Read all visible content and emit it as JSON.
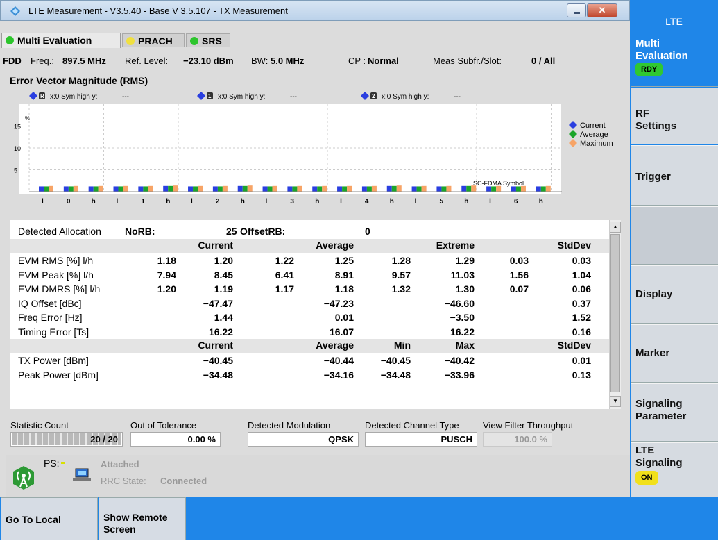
{
  "window": {
    "title": "LTE Measurement  - V3.5.40 - Base V 3.5.107 - TX Measurement"
  },
  "tabs": [
    {
      "label": "Multi Evaluation",
      "color": "#2cc52c"
    },
    {
      "label": "PRACH",
      "color": "#f0e040"
    },
    {
      "label": "SRS",
      "color": "#2cc52c"
    }
  ],
  "info": {
    "duplex": "FDD",
    "freq_label": "Freq.:",
    "freq_value": "897.5 MHz",
    "ref_label": "Ref. Level:",
    "ref_value": "−23.10 dBm",
    "bw_label": "BW:",
    "bw_value": "5.0 MHz",
    "cp_label": "CP :",
    "cp_value": "Normal",
    "meas_label": "Meas Subfr./Slot:",
    "meas_value": "0  / All"
  },
  "evm_title": "Error Vector Magnitude (RMS)",
  "markers": [
    {
      "num": "R",
      "text": "x:0 Sym high y:",
      "val": "---"
    },
    {
      "num": "1",
      "text": "x:0 Sym high y:",
      "val": "---"
    },
    {
      "num": "2",
      "text": "x:0 Sym high y:",
      "val": "---"
    }
  ],
  "chart_data": {
    "type": "bar",
    "ylabel": "%",
    "xlabel": "SC-FDMA Symbol",
    "ylim": [
      0,
      20
    ],
    "yticks": [
      "15",
      "10",
      "5"
    ],
    "categories": [
      "l",
      "0",
      "h",
      "l",
      "1",
      "h",
      "l",
      "2",
      "h",
      "l",
      "3",
      "h",
      "l",
      "4",
      "h",
      "l",
      "5",
      "h",
      "l",
      "6",
      "h"
    ],
    "series": [
      {
        "name": "Current",
        "color": "#2a3fe0",
        "values": [
          1.2,
          1.2,
          1.2,
          1.2,
          1.2,
          1.3,
          1.2,
          1.2,
          1.3,
          1.2,
          1.2,
          1.2,
          1.2,
          1.2,
          1.3,
          1.2,
          1.2,
          1.3,
          1.2,
          1.2,
          1.2
        ]
      },
      {
        "name": "Average",
        "color": "#1ba52a",
        "values": [
          1.2,
          1.2,
          1.2,
          1.2,
          1.2,
          1.3,
          1.2,
          1.2,
          1.3,
          1.2,
          1.2,
          1.2,
          1.2,
          1.2,
          1.3,
          1.2,
          1.2,
          1.3,
          1.2,
          1.2,
          1.2
        ]
      },
      {
        "name": "Maximum",
        "color": "#f7a466",
        "values": [
          1.3,
          1.3,
          1.3,
          1.3,
          1.3,
          1.4,
          1.3,
          1.3,
          1.4,
          1.3,
          1.3,
          1.3,
          1.3,
          1.3,
          1.4,
          1.3,
          1.3,
          1.4,
          1.3,
          1.3,
          1.3
        ]
      }
    ],
    "legend": "right"
  },
  "allocation": {
    "label": "Detected Allocation",
    "norb_label": "NoRB:",
    "norb_value": "25",
    "offset_label": "OffsetRB:",
    "offset_value": "0"
  },
  "headers1": [
    "Current",
    "Average",
    "Extreme",
    "StdDev"
  ],
  "rows1": [
    {
      "label": "EVM RMS [%] l/h",
      "values": [
        "1.18",
        "1.20",
        "1.22",
        "1.25",
        "1.28",
        "1.29",
        "0.03",
        "0.03"
      ]
    },
    {
      "label": "EVM Peak [%] l/h",
      "values": [
        "7.94",
        "8.45",
        "6.41",
        "8.91",
        "9.57",
        "11.03",
        "1.56",
        "1.04"
      ]
    },
    {
      "label": "EVM DMRS [%] l/h",
      "values": [
        "1.20",
        "1.19",
        "1.17",
        "1.18",
        "1.32",
        "1.30",
        "0.07",
        "0.06"
      ]
    },
    {
      "label": "IQ Offset [dBc]",
      "values": [
        "",
        "−47.47",
        "",
        "−47.23",
        "",
        "−46.60",
        "",
        "0.37"
      ]
    },
    {
      "label": "Freq Error [Hz]",
      "values": [
        "",
        "1.44",
        "",
        "0.01",
        "",
        "−3.50",
        "",
        "1.52"
      ]
    },
    {
      "label": "Timing Error [Ts]",
      "values": [
        "",
        "16.22",
        "",
        "16.07",
        "",
        "16.22",
        "",
        "0.16"
      ]
    }
  ],
  "headers2": [
    "Current",
    "Average",
    "Min",
    "Max",
    "StdDev"
  ],
  "rows2": [
    {
      "label": "TX Power [dBm]",
      "values": [
        "−40.45",
        "−40.44",
        "−40.45",
        "−40.42",
        "0.01"
      ]
    },
    {
      "label": "Peak Power [dBm]",
      "values": [
        "−34.48",
        "−34.16",
        "−34.48",
        "−33.96",
        "0.13"
      ]
    }
  ],
  "bottom": {
    "stat_label": "Statistic Count",
    "stat_value": "20 / 20",
    "stat_fraction": 1.0,
    "tol_label": "Out of Tolerance",
    "tol_value": "0.00  %",
    "mod_label": "Detected Modulation",
    "mod_value": "QPSK",
    "chan_label": "Detected Channel Type",
    "chan_value": "PUSCH",
    "vft_label": "View Filter Throughput",
    "vft_value": "100.0  %"
  },
  "status": {
    "ps_label": "PS:",
    "attached": "Attached",
    "rrc_label": "RRC State:",
    "rrc_value": "Connected"
  },
  "bottom_buttons": [
    {
      "label": "Go To Local"
    },
    {
      "label": "Show Remote Screen"
    }
  ],
  "right": {
    "header": "LTE",
    "buttons": [
      {
        "label": "Multi Evaluation",
        "badge": "RDY"
      },
      {
        "label": "RF Settings"
      },
      {
        "label": "Trigger"
      },
      {
        "label": ""
      },
      {
        "label": "Display"
      },
      {
        "label": "Marker"
      },
      {
        "label": "Signaling Parameter"
      },
      {
        "label": "LTE Signaling",
        "badge": "ON"
      }
    ]
  }
}
